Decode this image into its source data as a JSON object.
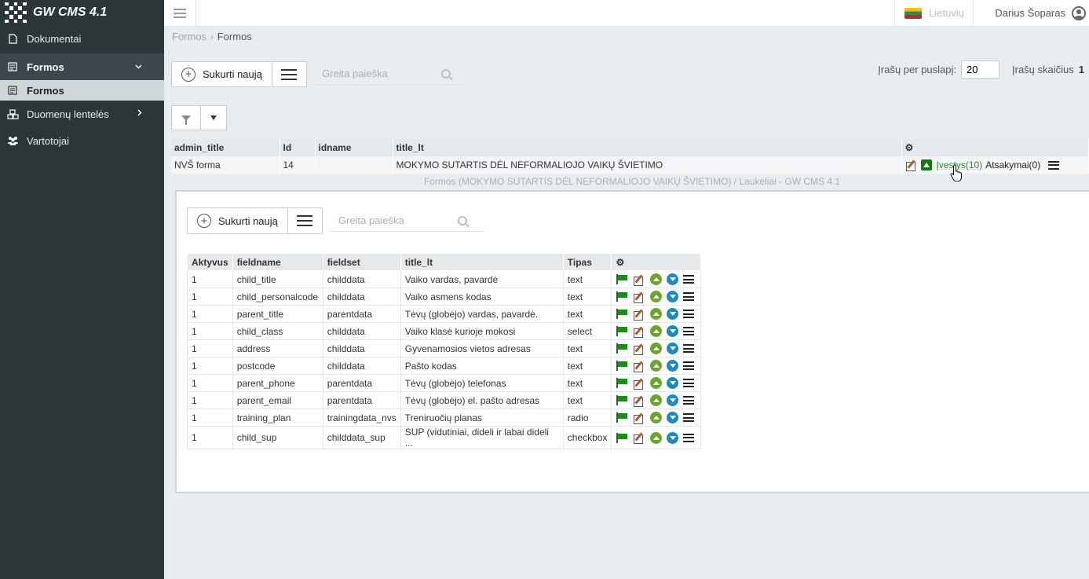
{
  "app": {
    "title": "GW CMS 4.1"
  },
  "sidebar": {
    "items": [
      {
        "label": "Dokumentai",
        "icon": "document-icon"
      },
      {
        "label": "Formos",
        "icon": "form-icon"
      },
      {
        "label": "Formos",
        "icon": "form-icon"
      },
      {
        "label": "Duomenų lentelės",
        "icon": "cubes-icon"
      },
      {
        "label": "Vartotojai",
        "icon": "users-icon"
      }
    ]
  },
  "topbar": {
    "language": "Lietuvių",
    "user": "Darius Šoparas"
  },
  "breadcrumb": {
    "root": "Formos",
    "current": "Formos"
  },
  "toolbar": {
    "create_label": "Sukurti naują",
    "search_placeholder": "Greita paieška",
    "perpage_label": "Įrašų per puslapį:",
    "perpage_value": "20",
    "count_label": "Įrašų skaičius",
    "count_value": "1"
  },
  "main_table": {
    "headers": [
      "admin_title",
      "Id",
      "idname",
      "title_lt"
    ],
    "row": {
      "admin_title": "NVŠ forma",
      "id": "14",
      "idname": "",
      "title_lt": "MOKYMO SUTARTIS DĖL NEFORMALIOJO VAIKŲ ŠVIETIMO",
      "fields_link": "Įvestys(10)",
      "answers_link": "Atsakymai(0)"
    }
  },
  "panel": {
    "title": "Formos (MOKYMO SUTARTIS DĖL NEFORMALIOJO VAIKŲ ŠVIETIMO) / Laukeliai - GW CMS 4.1",
    "create_label": "Sukurti naują",
    "search_placeholder": "Greita paieška",
    "headers": [
      "Aktyvus",
      "fieldname",
      "fieldset",
      "title_lt",
      "Tipas"
    ],
    "rows": [
      {
        "active": "1",
        "fieldname": "child_title",
        "fieldset": "childdata",
        "title_lt": "Vaiko vardas, pavardė",
        "type": "text"
      },
      {
        "active": "1",
        "fieldname": "child_personalcode",
        "fieldset": "childdata",
        "title_lt": "Vaiko asmens kodas",
        "type": "text"
      },
      {
        "active": "1",
        "fieldname": "parent_title",
        "fieldset": "parentdata",
        "title_lt": "Tėvų (globėjo) vardas, pavardė.",
        "type": "text"
      },
      {
        "active": "1",
        "fieldname": "child_class",
        "fieldset": "childdata",
        "title_lt": "Vaiko klasė kurioje mokosi",
        "type": "select"
      },
      {
        "active": "1",
        "fieldname": "address",
        "fieldset": "childdata",
        "title_lt": "Gyvenamosios vietos adresas",
        "type": "text"
      },
      {
        "active": "1",
        "fieldname": "postcode",
        "fieldset": "childdata",
        "title_lt": "Pašto kodas",
        "type": "text"
      },
      {
        "active": "1",
        "fieldname": "parent_phone",
        "fieldset": "parentdata",
        "title_lt": "Tėvų (globėjo) telefonas",
        "type": "text"
      },
      {
        "active": "1",
        "fieldname": "parent_email",
        "fieldset": "parentdata",
        "title_lt": "Tėvų (globėjo) el. pašto adresas",
        "type": "text"
      },
      {
        "active": "1",
        "fieldname": "training_plan",
        "fieldset": "trainingdata_nvs",
        "title_lt": "Treniruočių planas",
        "type": "radio"
      },
      {
        "active": "1",
        "fieldname": "child_sup",
        "fieldset": "childdata_sup",
        "title_lt": "SUP (vidutiniai, dideli ir labai dideli ...",
        "type": "checkbox"
      }
    ]
  }
}
